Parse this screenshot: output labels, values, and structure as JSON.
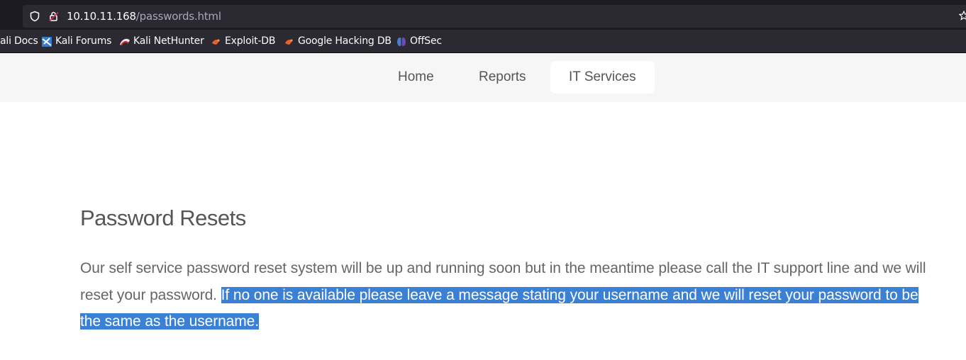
{
  "browser": {
    "url_host": "10.10.11.168",
    "url_path": "/passwords.html",
    "bookmarks": [
      {
        "label": "ali Docs",
        "icon": "kali-docs-icon"
      },
      {
        "label": "Kali Forums",
        "icon": "kali-forums-icon"
      },
      {
        "label": "Kali NetHunter",
        "icon": "kali-nethunter-icon"
      },
      {
        "label": "Exploit-DB",
        "icon": "exploit-db-icon"
      },
      {
        "label": "Google Hacking DB",
        "icon": "google-hacking-db-icon"
      },
      {
        "label": "OffSec",
        "icon": "offsec-icon"
      }
    ]
  },
  "nav": {
    "items": [
      {
        "label": "Home"
      },
      {
        "label": "Reports"
      },
      {
        "label": "IT Services",
        "active": true
      }
    ]
  },
  "content": {
    "title": "Password Resets",
    "paragraph_part1": "Our self service password reset system will be up and running soon but in the meantime please call the IT support line and we will reset your password. ",
    "paragraph_selected": "If no one is available please leave a message stating your username and we will reset your password to be the same as the username."
  },
  "colors": {
    "selection": "#3a81d6",
    "nav_background": "#f6f6f6",
    "browser_toolbar": "#1c1b22",
    "bookmarks_bar": "#2b2a33"
  }
}
